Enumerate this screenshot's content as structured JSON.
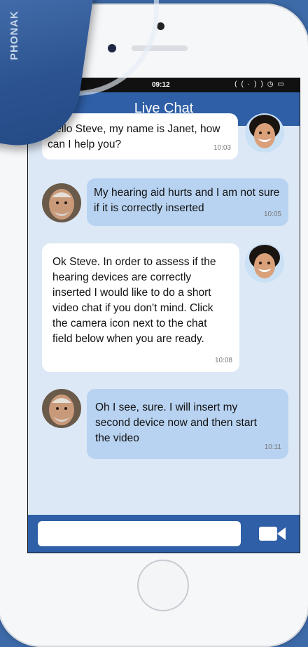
{
  "device": {
    "brand_label": "PHONAK"
  },
  "status_bar": {
    "time": "09:12"
  },
  "header": {
    "back_icon": "chevron-left-icon",
    "title": "Live Chat"
  },
  "messages": [
    {
      "sender": "agent",
      "text": "Hello Steve, my name is Janet, how can I help you?",
      "time": "10:03"
    },
    {
      "sender": "user",
      "text": "My hearing aid hurts and I am not sure if it is correctly inserted",
      "time": "10:05"
    },
    {
      "sender": "agent",
      "text": "Ok Steve. In order to assess if the hearing devices are correctly inserted I would like to do a short video chat if you don't mind. Click the camera icon next to the chat field below when you are ready.",
      "time": "10:08"
    },
    {
      "sender": "user",
      "text": "Oh I see, sure. I will insert my second device now and then start the video",
      "time": "10:11"
    }
  ],
  "composer": {
    "value": "",
    "placeholder": "",
    "video_icon": "video-camera-icon"
  },
  "colors": {
    "accent": "#2f5fa6",
    "background": "#dce8f6",
    "user_bubble": "#b8d3f1",
    "agent_bubble": "#ffffff"
  }
}
